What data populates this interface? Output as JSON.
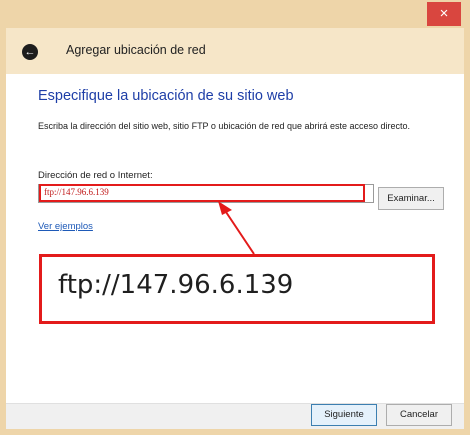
{
  "window": {
    "close_icon": "×"
  },
  "header": {
    "back_icon": "←",
    "title": "Agregar ubicación de red"
  },
  "main": {
    "heading": "Especifique la ubicación de su sitio web",
    "description": "Escriba la dirección del sitio web, sitio FTP o ubicación de red que abrirá este acceso directo.",
    "address_label": "Dirección de red o Internet:",
    "address_value": "ftp://147.96.6.139",
    "browse_label": "Examinar...",
    "examples_link": "Ver ejemplos"
  },
  "annotation": {
    "callout_text": "ftp://147.96.6.139",
    "color": "#e31b1b"
  },
  "footer": {
    "next_label": "Siguiente",
    "cancel_label": "Cancelar"
  }
}
